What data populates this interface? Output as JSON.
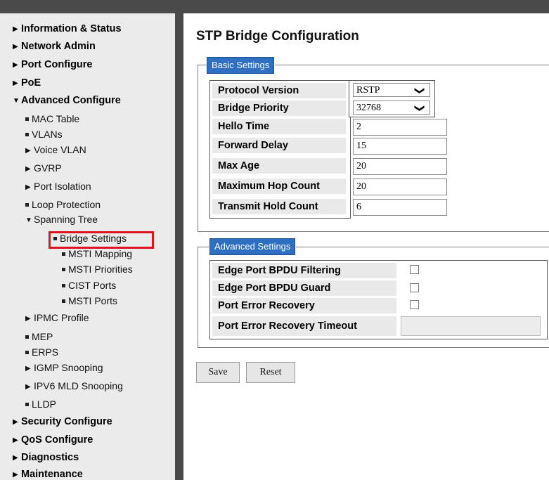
{
  "nav": {
    "information_status": "Information & Status",
    "network_admin": "Network Admin",
    "port_configure": "Port Configure",
    "poe": "PoE",
    "advanced_configure": "Advanced Configure",
    "mac_table": "MAC Table",
    "vlans": "VLANs",
    "voice_vlan": "Voice VLAN",
    "gvrp": "GVRP",
    "port_isolation": "Port Isolation",
    "loop_protection": "Loop Protection",
    "spanning_tree": "Spanning Tree",
    "bridge_settings": "Bridge Settings",
    "msti_mapping": "MSTI Mapping",
    "msti_priorities": "MSTI Priorities",
    "cist_ports": "CIST Ports",
    "msti_ports": "MSTI Ports",
    "ipmc_profile": "IPMC Profile",
    "mep": "MEP",
    "erps": "ERPS",
    "igmp_snooping": "IGMP Snooping",
    "ipv6_mld_snooping": "IPV6 MLD Snooping",
    "lldp": "LLDP",
    "security_configure": "Security Configure",
    "qos_configure": "QoS Configure",
    "diagnostics": "Diagnostics",
    "maintenance": "Maintenance"
  },
  "page": {
    "title": "STP Bridge Configuration"
  },
  "basic": {
    "legend": "Basic Settings",
    "protocol_version_label": "Protocol Version",
    "protocol_version_value": "RSTP",
    "bridge_priority_label": "Bridge Priority",
    "bridge_priority_value": "32768",
    "hello_time_label": "Hello Time",
    "hello_time_value": "2",
    "forward_delay_label": "Forward Delay",
    "forward_delay_value": "15",
    "max_age_label": "Max Age",
    "max_age_value": "20",
    "max_hop_label": "Maximum Hop Count",
    "max_hop_value": "20",
    "tx_hold_label": "Transmit Hold Count",
    "tx_hold_value": "6"
  },
  "advanced": {
    "legend": "Advanced Settings",
    "edge_bpdu_filtering_label": "Edge Port BPDU Filtering",
    "edge_bpdu_guard_label": "Edge Port BPDU Guard",
    "port_error_recovery_label": "Port Error Recovery",
    "port_error_recovery_timeout_label": "Port Error Recovery Timeout"
  },
  "buttons": {
    "save": "Save",
    "reset": "Reset"
  },
  "colors": {
    "legend_bg": "#2f6fc1",
    "highlight": "#e0141e",
    "chrome": "#4a4a4a"
  }
}
